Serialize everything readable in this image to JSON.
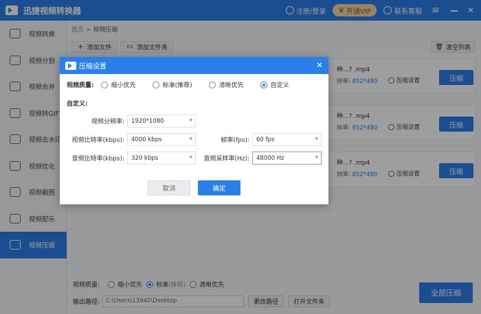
{
  "app": {
    "title": "迅捷视频转换器",
    "login": "注册/登录",
    "vip": "开通VIP",
    "support": "联系客服"
  },
  "sidebar": {
    "items": [
      {
        "label": "视频转换",
        "icon": "convert-icon"
      },
      {
        "label": "视频分割",
        "icon": "split-icon"
      },
      {
        "label": "视频合并",
        "icon": "merge-icon"
      },
      {
        "label": "视频转GIF",
        "icon": "gif-icon"
      },
      {
        "label": "视频去水印",
        "icon": "watermark-icon"
      },
      {
        "label": "视频优化",
        "icon": "optimize-icon"
      },
      {
        "label": "视频截图",
        "icon": "screenshot-icon"
      },
      {
        "label": "视频配乐",
        "icon": "music-icon"
      },
      {
        "label": "视频压缩",
        "icon": "compress-icon",
        "active": true
      }
    ]
  },
  "breadcrumb": {
    "home": "首页",
    "sep": ">",
    "current": "视频压缩"
  },
  "toolbar": {
    "add_file": "添加文件",
    "add_folder": "添加文件夹",
    "clear_list": "清空列表"
  },
  "files": [
    {
      "name": "种...? .mp4",
      "res_label": "辨率:",
      "res": "852*480",
      "settings": "压缩设置",
      "compress": "压缩"
    },
    {
      "name": "种...? .mp4",
      "res_label": "辨率:",
      "res": "852*480",
      "settings": "压缩设置",
      "compress": "压缩"
    },
    {
      "name": "种...? .mp4",
      "res_label": "辨率:",
      "res": "852*480",
      "settings": "压缩设置",
      "compress": "压缩"
    }
  ],
  "bottom": {
    "quality_label": "视频质量:",
    "options": [
      "缩小优先",
      "标准",
      "清晰优先"
    ],
    "recommended": "(推荐)",
    "output_label": "输出路径:",
    "output_path": "C:\\Users\\13940\\Desktop",
    "change_path": "更改路径",
    "open_folder": "打开文件夹",
    "compress_all": "全部压缩"
  },
  "dialog": {
    "title": "压缩设置",
    "quality_label": "视频质量:",
    "options": [
      "缩小优先",
      "标准(推荐)",
      "清晰优先",
      "自定义"
    ],
    "selected_option": "自定义",
    "custom_label": "自定义:",
    "resolution_label": "视频分辨率:",
    "resolution": "1920*1080",
    "vbitrate_label": "视频比特率(kbps):",
    "vbitrate": "4000 kbps",
    "fps_label": "帧率(fps):",
    "fps": "60 fps",
    "abitrate_label": "音频比特率(kbps):",
    "abitrate": "320 kbps",
    "samplerate_label": "音频采样率(Hz):",
    "samplerate": "48000 Hz",
    "cancel": "取消",
    "ok": "确定"
  },
  "colors": {
    "accent": "#2a7fe8",
    "vip_bg": "#f3d9a6"
  }
}
